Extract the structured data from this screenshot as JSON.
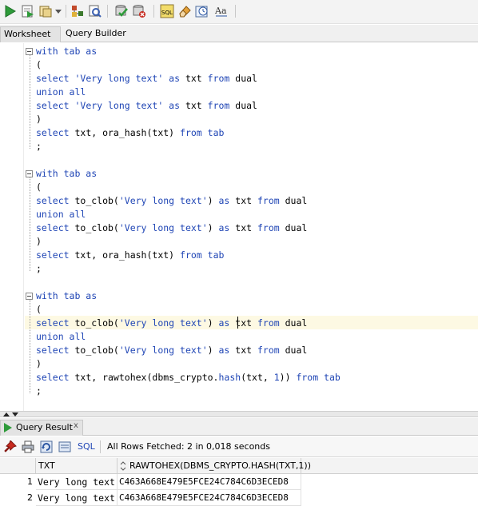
{
  "toolbar": {
    "buttons": [
      "run-statement",
      "run-script",
      "autotrace",
      "explain-plan",
      "sql-tuning-advisor",
      "commit",
      "rollback",
      "unshared-sql",
      "clear",
      "sql-history",
      "format-case"
    ]
  },
  "tabs": {
    "worksheet": "Worksheet",
    "query_builder": "Query Builder"
  },
  "editor": {
    "lines": [
      [
        {
          "t": "with tab as",
          "c": "kw"
        }
      ],
      [
        {
          "t": "(",
          "c": ""
        }
      ],
      [
        {
          "t": "select ",
          "c": "kw"
        },
        {
          "t": "'Very long text'",
          "c": "str"
        },
        {
          "t": " as ",
          "c": "kw"
        },
        {
          "t": "txt ",
          "c": ""
        },
        {
          "t": "from",
          "c": "kw"
        },
        {
          "t": " dual",
          "c": ""
        }
      ],
      [
        {
          "t": "union all",
          "c": "kw"
        }
      ],
      [
        {
          "t": "select ",
          "c": "kw"
        },
        {
          "t": "'Very long text'",
          "c": "str"
        },
        {
          "t": " as ",
          "c": "kw"
        },
        {
          "t": "txt ",
          "c": ""
        },
        {
          "t": "from",
          "c": "kw"
        },
        {
          "t": " dual",
          "c": ""
        }
      ],
      [
        {
          "t": ")",
          "c": ""
        }
      ],
      [
        {
          "t": "select ",
          "c": "kw"
        },
        {
          "t": "txt, ora_hash(txt) ",
          "c": ""
        },
        {
          "t": "from tab",
          "c": "kw"
        }
      ],
      [
        {
          "t": ";",
          "c": ""
        }
      ],
      [],
      [
        {
          "t": "with tab as",
          "c": "kw"
        }
      ],
      [
        {
          "t": "(",
          "c": ""
        }
      ],
      [
        {
          "t": "select ",
          "c": "kw"
        },
        {
          "t": "to_clob(",
          "c": ""
        },
        {
          "t": "'Very long text'",
          "c": "str"
        },
        {
          "t": ") ",
          "c": ""
        },
        {
          "t": "as ",
          "c": "kw"
        },
        {
          "t": "txt ",
          "c": ""
        },
        {
          "t": "from",
          "c": "kw"
        },
        {
          "t": " dual",
          "c": ""
        }
      ],
      [
        {
          "t": "union all",
          "c": "kw"
        }
      ],
      [
        {
          "t": "select ",
          "c": "kw"
        },
        {
          "t": "to_clob(",
          "c": ""
        },
        {
          "t": "'Very long text'",
          "c": "str"
        },
        {
          "t": ") ",
          "c": ""
        },
        {
          "t": "as ",
          "c": "kw"
        },
        {
          "t": "txt ",
          "c": ""
        },
        {
          "t": "from",
          "c": "kw"
        },
        {
          "t": " dual",
          "c": ""
        }
      ],
      [
        {
          "t": ")",
          "c": ""
        }
      ],
      [
        {
          "t": "select ",
          "c": "kw"
        },
        {
          "t": "txt, ora_hash(txt) ",
          "c": ""
        },
        {
          "t": "from tab",
          "c": "kw"
        }
      ],
      [
        {
          "t": ";",
          "c": ""
        }
      ],
      [],
      [
        {
          "t": "with tab as",
          "c": "kw"
        }
      ],
      [
        {
          "t": "(",
          "c": ""
        }
      ],
      [
        {
          "t": "select ",
          "c": "kw"
        },
        {
          "t": "to_clob(",
          "c": ""
        },
        {
          "t": "'Very long text'",
          "c": "str"
        },
        {
          "t": ") ",
          "c": ""
        },
        {
          "t": "as ",
          "c": "kw"
        },
        {
          "t": "txt ",
          "c": ""
        },
        {
          "t": "from",
          "c": "kw"
        },
        {
          "t": " dual",
          "c": ""
        }
      ],
      [
        {
          "t": "union all",
          "c": "kw"
        }
      ],
      [
        {
          "t": "select ",
          "c": "kw"
        },
        {
          "t": "to_clob(",
          "c": ""
        },
        {
          "t": "'Very long text'",
          "c": "str"
        },
        {
          "t": ") ",
          "c": ""
        },
        {
          "t": "as ",
          "c": "kw"
        },
        {
          "t": "txt ",
          "c": ""
        },
        {
          "t": "from",
          "c": "kw"
        },
        {
          "t": " dual",
          "c": ""
        }
      ],
      [
        {
          "t": ")",
          "c": ""
        }
      ],
      [
        {
          "t": "select ",
          "c": "kw"
        },
        {
          "t": "txt, rawtohex(dbms_crypto.",
          "c": ""
        },
        {
          "t": "hash",
          "c": "kw"
        },
        {
          "t": "(txt, ",
          "c": ""
        },
        {
          "t": "1",
          "c": "num"
        },
        {
          "t": ")) ",
          "c": ""
        },
        {
          "t": "from tab",
          "c": "kw"
        }
      ],
      [
        {
          "t": ";",
          "c": ""
        }
      ]
    ]
  },
  "results": {
    "tab_label": "Query Result",
    "close_label": "x",
    "sql_label": "SQL",
    "status": "All Rows Fetched: 2 in 0,018 seconds",
    "columns": [
      "TXT",
      "RAWTOHEX(DBMS_CRYPTO.HASH(TXT,1))"
    ],
    "rows": [
      {
        "num": "1",
        "txt": "Very long text",
        "hash": "C463A668E479E5FCE24C784C6D3ECED8"
      },
      {
        "num": "2",
        "txt": "Very long text",
        "hash": "C463A668E479E5FCE24C784C6D3ECED8"
      }
    ]
  },
  "colors": {
    "keyword": "#1f45b5",
    "current_line": "#fdf9e3",
    "run_green": "#2e9b3a"
  }
}
